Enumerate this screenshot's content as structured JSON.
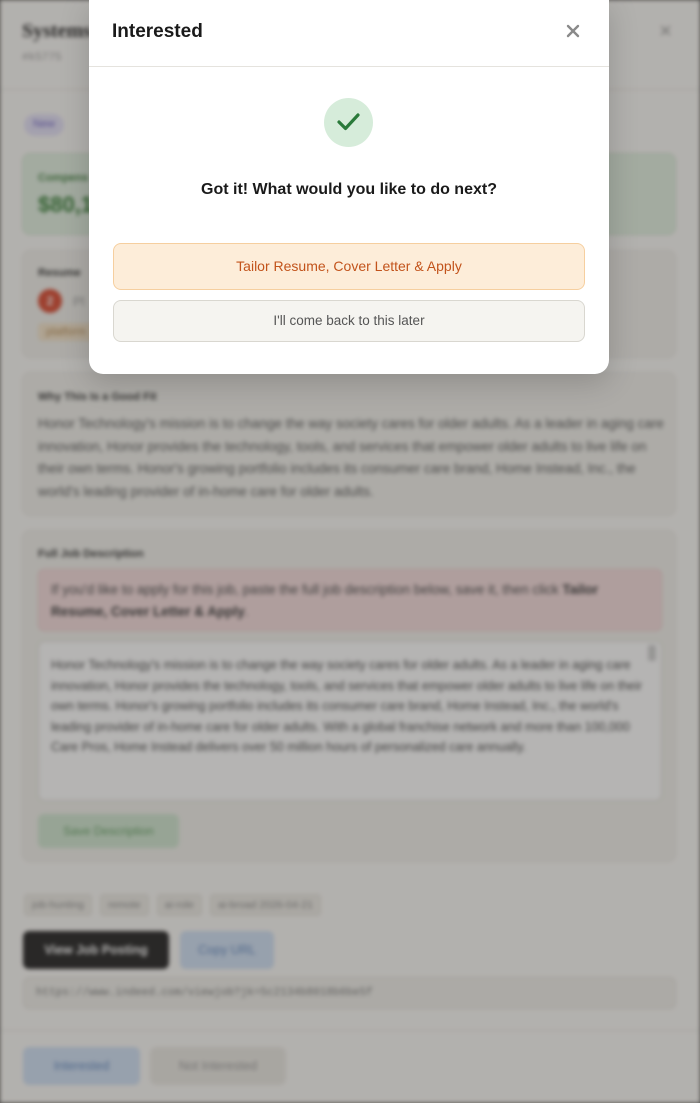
{
  "background": {
    "job_title": "Systems",
    "job_id": "#k5775",
    "status_badge": "New",
    "compensation": {
      "label": "Compens",
      "value": "$80,1"
    },
    "resume": {
      "label": "Resume",
      "number": "2",
      "text": "Pl",
      "tag": "platform"
    },
    "fit": {
      "label": "Why This Is a Good Fit",
      "text": "Honor Technology's mission is to change the way society cares for older adults. As a leader in aging care innovation, Honor provides the technology, tools, and services that empower older adults to live life on their own terms. Honor's growing portfolio includes its consumer care brand, Home Instead, Inc., the world's leading provider of in-home care for older adults."
    },
    "description": {
      "label": "Full Job Description",
      "alert_text": "If you'd like to apply for this job, paste the full job description below, save it, then click",
      "alert_bold": "Tailor Resume, Cover Letter & Apply",
      "alert_end": ".",
      "body": "Honor Technology's mission is to change the way society cares for older adults. As a leader in aging care innovation, Honor provides the technology, tools, and services that empower older adults to live life on their own terms. Honor's growing portfolio includes its consumer care brand, Home Instead, Inc., the world's leading provider of in-home care for older adults. With a global franchise network and more than 100,000 Care Pros, Home Instead delivers over 50 million hours of personalized care annually.",
      "save_label": "Save Description"
    },
    "tags": [
      "job-hunting",
      "remote",
      "ai-role",
      "ai-broad 2026-04-21"
    ],
    "view_label": "View Job Posting",
    "copy_label": "Copy URL",
    "url": "https://www.indeed.com/viewjob?jk=5c2134b8018b6be5f",
    "interested_label": "Interested",
    "not_interested_label": "Not Interested"
  },
  "modal": {
    "title": "Interested",
    "question": "Got it! What would you like to do next?",
    "primary_label": "Tailor Resume, Cover Letter & Apply",
    "secondary_label": "I'll come back to this later"
  },
  "colors": {
    "primary_text": "#c2531b",
    "primary_bg": "#fdedd9",
    "check_bg": "#d6ecda",
    "check_stroke": "#2a7a3a"
  },
  "icons": {
    "close": "close-icon",
    "check": "checkmark-icon"
  }
}
